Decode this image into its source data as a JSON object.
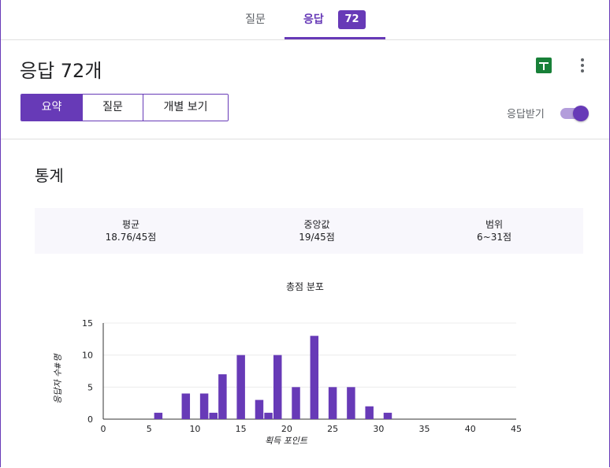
{
  "tabs": {
    "questions": "질문",
    "responses": "응답",
    "response_count": "72"
  },
  "header": {
    "title": "응답 72개",
    "sheets_icon": "sheets-icon",
    "more_icon": "more-vert-icon"
  },
  "segments": [
    "요약",
    "질문",
    "개별 보기"
  ],
  "accepting": {
    "label": "응답받기",
    "on": true
  },
  "section_title": "통계",
  "stats": [
    {
      "label": "평균",
      "value": "18.76/45점"
    },
    {
      "label": "중앙값",
      "value": "19/45점"
    },
    {
      "label": "범위",
      "value": "6~31점"
    }
  ],
  "colors": {
    "accent": "#673ab7",
    "bar": "#673ab7"
  },
  "chart_data": {
    "type": "bar",
    "title": "총점 분포",
    "xlabel": "획득 포인트",
    "ylabel": "응답자 수#명",
    "xlim": [
      0,
      45
    ],
    "ylim": [
      0,
      15
    ],
    "xticks": [
      "0",
      "5",
      "10",
      "15",
      "20",
      "25",
      "30",
      "35",
      "40",
      "45"
    ],
    "yticks": [
      "0",
      "5",
      "10",
      "15"
    ],
    "x": [
      6,
      9,
      11,
      12,
      13,
      15,
      17,
      18,
      19,
      21,
      23,
      25,
      27,
      29,
      31
    ],
    "values": [
      1,
      4,
      4,
      1,
      7,
      10,
      3,
      1,
      10,
      5,
      13,
      5,
      5,
      2,
      1
    ],
    "grid": true
  }
}
